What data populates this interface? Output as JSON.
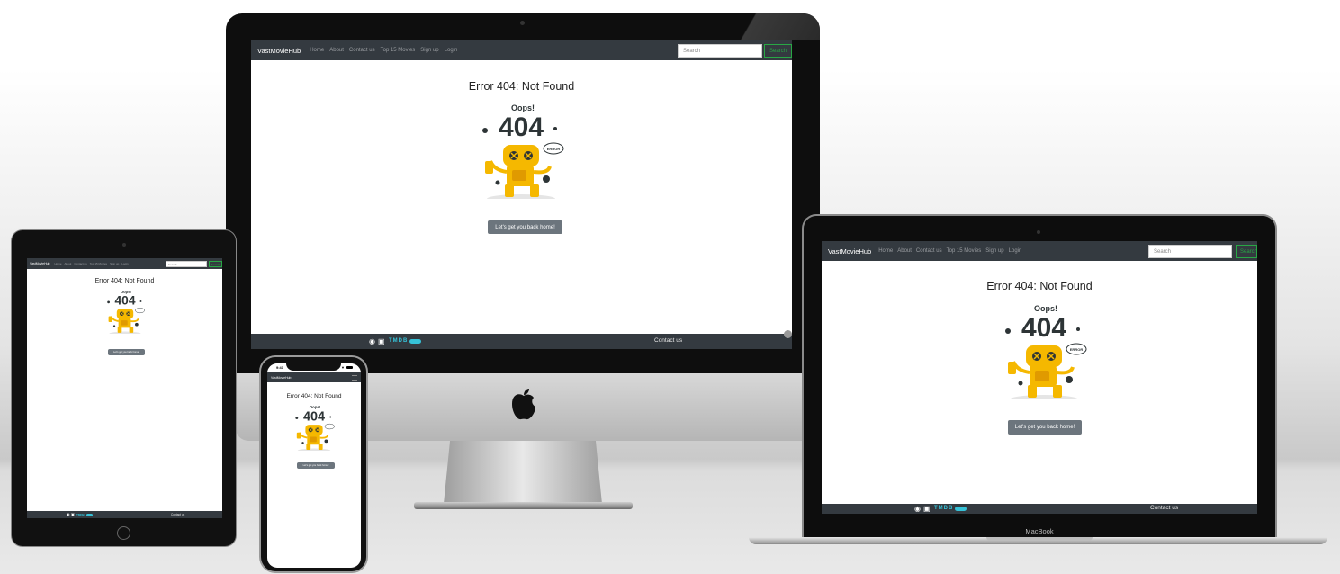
{
  "site": {
    "brand": "VastMovieHub",
    "nav": [
      "Home",
      "About",
      "Contact us",
      "Top 15 Movies",
      "Sign up",
      "Login"
    ],
    "search_placeholder": "Search",
    "search_button": "Search",
    "error_title": "Error 404: Not Found",
    "illustration_oops": "Oops!",
    "illustration_404": "404",
    "illustration_error": "ERROR",
    "home_button": "Let's get you back home!",
    "footer_contact": "Contact us",
    "footer_tmdb": "TMDB"
  },
  "devices": {
    "phone_time": "9:41",
    "laptop_label": "MacBook"
  },
  "colors": {
    "nav_bg": "#343a40",
    "button_gray": "#6c757d",
    "search_green": "#28a745",
    "tmdb_teal": "#36c2d8",
    "robot_yellow": "#f5b800"
  },
  "icons": [
    "github-icon",
    "linkedin-icon",
    "apple-logo-icon",
    "scroll-top-icon"
  ]
}
